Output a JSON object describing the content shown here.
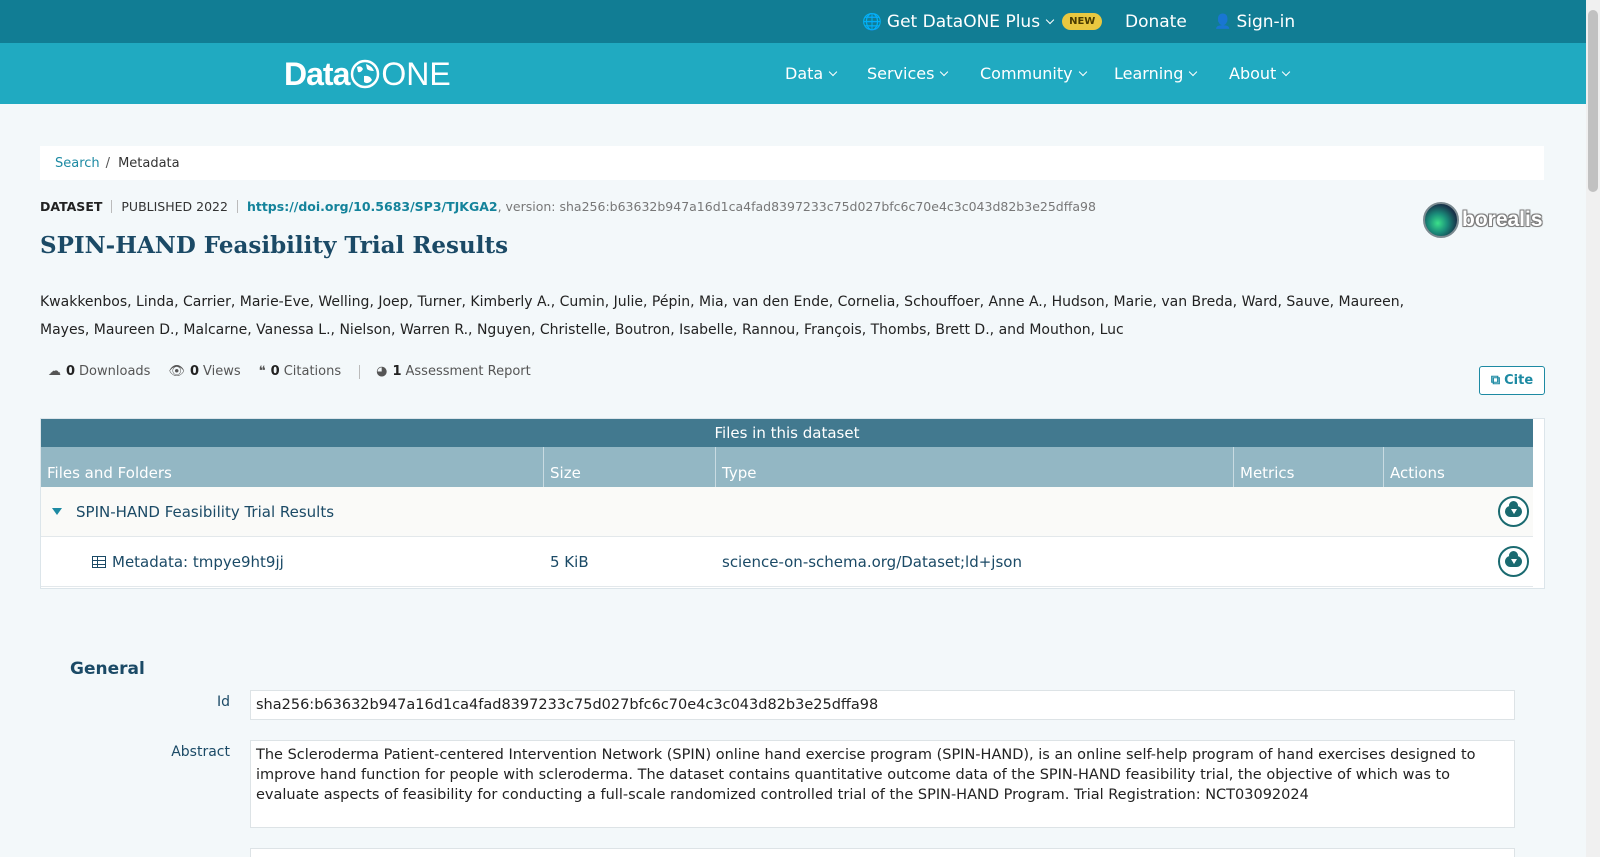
{
  "topbar": {
    "plus_label": "Get DataONE Plus",
    "new_badge": "NEW",
    "donate": "Donate",
    "signin": "Sign-in"
  },
  "logo": {
    "part1": "Data",
    "part2": "ONE"
  },
  "nav": [
    "Data",
    "Services",
    "Community",
    "Learning",
    "About"
  ],
  "breadcrumb": {
    "search": "Search",
    "sep": "/",
    "current": "Metadata"
  },
  "meta": {
    "type": "DATASET",
    "published": "PUBLISHED 2022",
    "doi": "https://doi.org/10.5683/SP3/TJKGA2",
    "version": ", version: sha256:b63632b947a16d1ca4fad8397233c75d027bfc6c70e4c3c043d82b3e25dffa98"
  },
  "title": "SPIN-HAND Feasibility Trial Results",
  "repository": "borealis",
  "authors": "Kwakkenbos, Linda, Carrier, Marie-Eve, Welling, Joep, Turner, Kimberly A., Cumin, Julie, Pépin, Mia, van den Ende, Cornelia, Schouffoer, Anne A., Hudson, Marie, van Breda, Ward, Sauve, Maureen, Mayes, Maureen D., Malcarne, Vanessa L., Nielson, Warren R., Nguyen, Christelle, Boutron, Isabelle, Rannou, François, Thombs, Brett D., and Mouthon, Luc",
  "metrics": {
    "downloads": {
      "count": "0",
      "label": "Downloads"
    },
    "views": {
      "count": "0",
      "label": "Views"
    },
    "citations": {
      "count": "0",
      "label": "Citations"
    },
    "assessment": {
      "count": "1",
      "label": "Assessment Report"
    }
  },
  "cite_label": "Cite",
  "files": {
    "heading": "Files in this dataset",
    "columns": [
      "Files and Folders",
      "Size",
      "Type",
      "Metrics",
      "Actions"
    ],
    "folder": {
      "name": "SPIN-HAND Feasibility Trial Results"
    },
    "items": [
      {
        "name": "Metadata: tmpye9ht9jj",
        "size": "5 KiB",
        "type": "science-on-schema.org/Dataset;ld+json"
      }
    ]
  },
  "general": {
    "heading": "General",
    "id_label": "Id",
    "id_value": "sha256:b63632b947a16d1ca4fad8397233c75d027bfc6c70e4c3c043d82b3e25dffa98",
    "abstract_label": "Abstract",
    "abstract_value": "The Scleroderma Patient-centered Intervention Network (SPIN) online hand exercise program (SPIN-HAND), is an online self-help program of hand exercises designed to improve hand function for people with scleroderma. The dataset contains quantitative outcome data of the SPIN-HAND feasibility trial, the objective of which was to evaluate aspects of feasibility for conducting a full-scale randomized controlled trial of the SPIN-HAND Program. Trial Registration: NCT03092024"
  },
  "colors": {
    "topbar": "#117d94",
    "navbar": "#20aac1",
    "accent": "#1d8aa3",
    "table_header": "#42798f",
    "column_header": "#93b7c4",
    "title": "#1b4a66"
  }
}
